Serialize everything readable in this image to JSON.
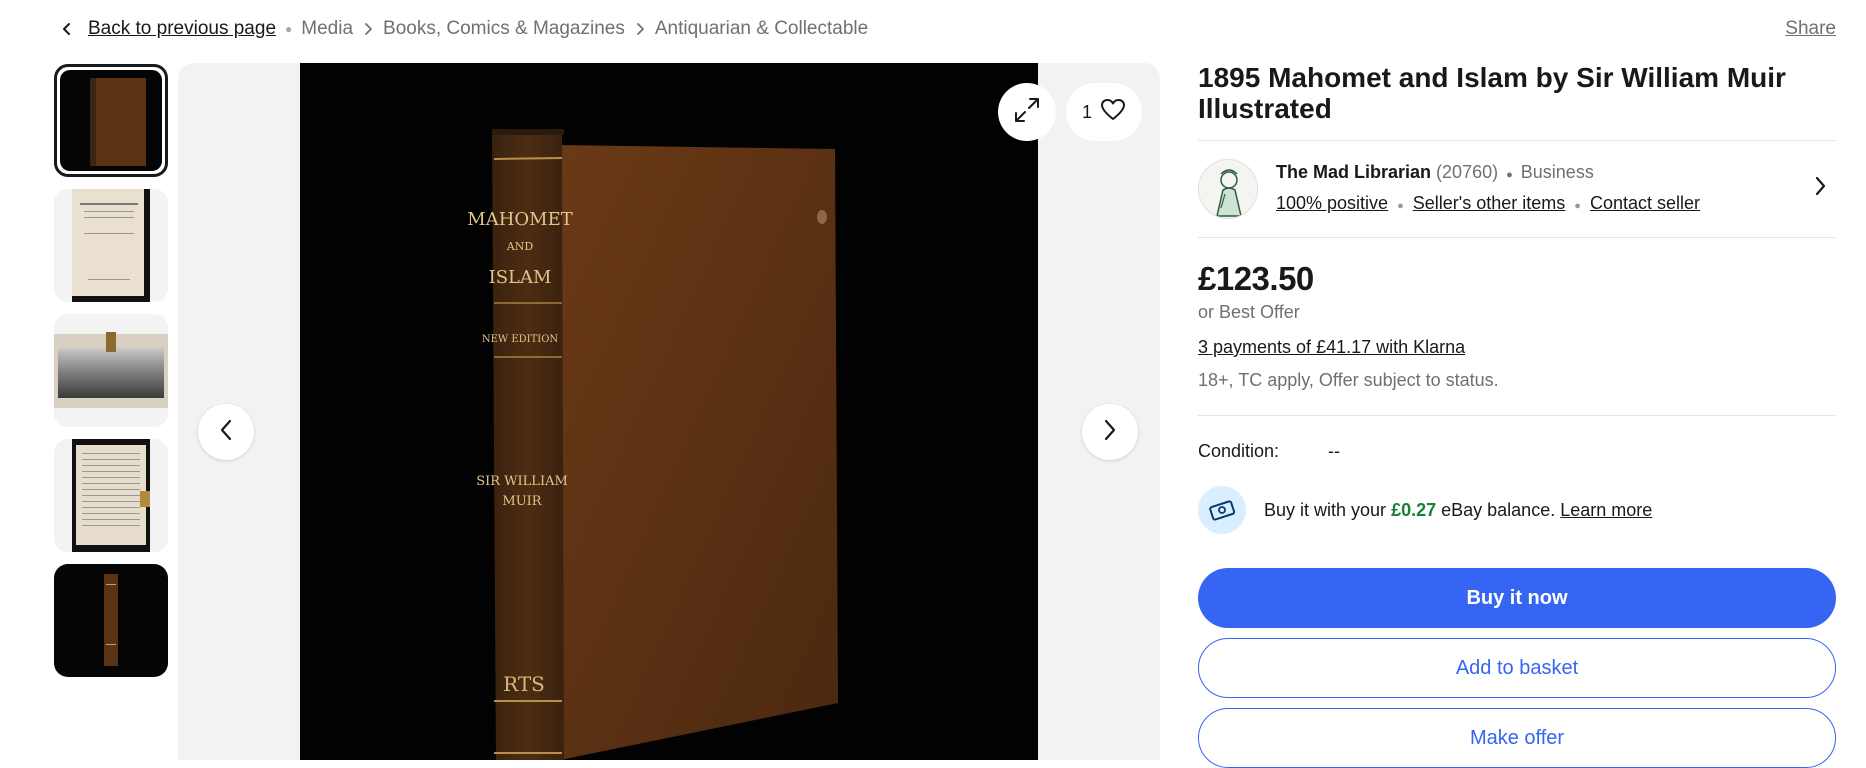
{
  "breadcrumb": {
    "back_label": "Back to previous page",
    "items": [
      "Media",
      "Books, Comics & Magazines",
      "Antiquarian & Collectable"
    ]
  },
  "share_label": "Share",
  "gallery": {
    "thumbnail_count": 5,
    "active_index": 0,
    "watch_count": "1",
    "spine_text": {
      "title_line1": "MAHOMET",
      "title_and": "AND",
      "title_line2": "ISLAM",
      "edition": "NEW EDITION",
      "author_line1": "SIR WILLIAM",
      "author_line2": "MUIR",
      "publisher_mark": "RTS"
    }
  },
  "listing": {
    "title": "1895 Mahomet and Islam by Sir William Muir Illustrated",
    "price": "£123.50",
    "best_offer": "or Best Offer",
    "klarna": "3 payments of £41.17 with Klarna",
    "terms": "18+, TC apply, Offer subject to status.",
    "condition_label": "Condition:",
    "condition_value": "--"
  },
  "seller": {
    "name": "The Mad Librarian",
    "feedback_count": "(20760)",
    "type": "Business",
    "positive": "100% positive",
    "other_items": "Seller's other items",
    "contact": "Contact seller"
  },
  "balance": {
    "prefix": "Buy it with your",
    "amount": "£0.27",
    "suffix": "eBay balance.",
    "learn_more": "Learn more"
  },
  "actions": {
    "buy_now": "Buy it now",
    "add_to_basket": "Add to basket",
    "make_offer": "Make offer"
  },
  "colors": {
    "accent_blue": "#3665f3",
    "balance_green": "#1a7f37",
    "book_brown": "#5a3214"
  },
  "icons": [
    "chevron-left-icon",
    "chevron-right-icon",
    "expand-icon",
    "heart-icon",
    "balance-card-icon"
  ]
}
